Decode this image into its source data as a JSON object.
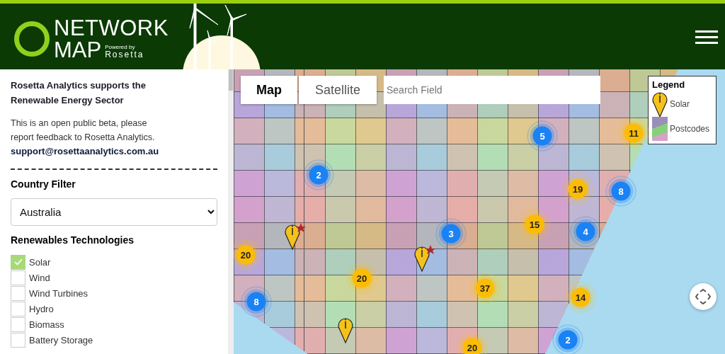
{
  "header": {
    "title_line1": "NETWORK",
    "title_line2": "MAP",
    "powered_by": "Powered by",
    "brand": "Rosetta"
  },
  "sidebar": {
    "heading": "Rosetta Analytics supports the Renewable Energy Sector",
    "intro": "This is an open public beta, please report feedback to Rosetta Analytics.",
    "email": "support@rosettaanalytics.com.au",
    "country_filter": {
      "label": "Country Filter",
      "value": "Australia"
    },
    "technologies": {
      "label": "Renewables Technologies",
      "items": [
        {
          "label": "Solar",
          "checked": true
        },
        {
          "label": "Wind",
          "checked": false
        },
        {
          "label": "Wind Turbines",
          "checked": false
        },
        {
          "label": "Hydro",
          "checked": false
        },
        {
          "label": "Biomass",
          "checked": false
        },
        {
          "label": "Battery Storage",
          "checked": false
        }
      ]
    }
  },
  "map": {
    "tabs": [
      {
        "label": "Map",
        "selected": true
      },
      {
        "label": "Satellite",
        "selected": false
      }
    ],
    "search": {
      "placeholder": "Search Field"
    },
    "legend": {
      "title": "Legend",
      "items": [
        {
          "kind": "pin",
          "label": "Solar"
        },
        {
          "kind": "swatch",
          "label": "Postcodes"
        }
      ]
    },
    "markers": [
      {
        "kind": "cluster",
        "count": "2",
        "color": "#1a82f5"
      },
      {
        "kind": "cluster",
        "count": "5",
        "color": "#1a82f5"
      },
      {
        "kind": "cluster",
        "count": "11",
        "color": "#fcbc05"
      },
      {
        "kind": "cluster",
        "count": "19",
        "color": "#fcbc05"
      },
      {
        "kind": "cluster",
        "count": "8",
        "color": "#1a82f5"
      },
      {
        "kind": "cluster",
        "count": "15",
        "color": "#fcbc05"
      },
      {
        "kind": "cluster",
        "count": "4",
        "color": "#1a82f5"
      },
      {
        "kind": "cluster",
        "count": "3",
        "color": "#1a82f5"
      },
      {
        "kind": "cluster",
        "count": "20",
        "color": "#fcbc05"
      },
      {
        "kind": "pin",
        "starred": true
      },
      {
        "kind": "cluster",
        "count": "20",
        "color": "#fcbc05"
      },
      {
        "kind": "pin",
        "starred": true
      },
      {
        "kind": "cluster",
        "count": "37",
        "color": "#fcbc05"
      },
      {
        "kind": "cluster",
        "count": "14",
        "color": "#fcbc05"
      },
      {
        "kind": "cluster",
        "count": "8",
        "color": "#1a82f5"
      },
      {
        "kind": "cluster",
        "count": "2",
        "color": "#1a82f5"
      },
      {
        "kind": "cluster",
        "count": "20",
        "color": "#fcbc05"
      },
      {
        "kind": "pin",
        "starred": false
      }
    ]
  }
}
